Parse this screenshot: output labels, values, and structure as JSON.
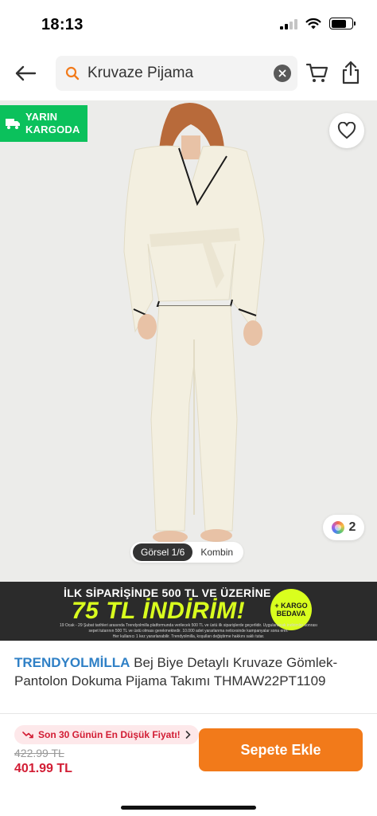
{
  "status": {
    "time": "18:13"
  },
  "search": {
    "value": "Kruvaze Pijama"
  },
  "badge": {
    "line1": "YARIN",
    "line2": "KARGODA",
    "color": "#0bc15c"
  },
  "gallery": {
    "active_label": "Görsel 1/6",
    "other_label": "Kombin",
    "color_count": "2"
  },
  "promo": {
    "line1": "İLK SİPARİŞİNDE 500 TL VE ÜZERİNE",
    "line2": "75 TL İNDİRİM!",
    "badge_line1": "+ KARGO",
    "badge_line2": "BEDAVA",
    "fine_print": [
      "19 Ocak - 29 Şubat tarihleri arasında Trendyolmilla platformunda verilecek 500 TL ve üstü ilk siparişlerde geçerlidir. Uygulanacak indirimler sonrası",
      "sepet tutarının 500 TL ve üstü olması gerekmektedir. 10.000 adet yararlanma neticesinde kampanyalar sona erer.",
      "Her kullanıcı 1 kez yararlanabilir. Trendyolmilla, koşulları değiştirme hakkını saklı tutar."
    ],
    "accent": "#d9ff1e"
  },
  "product": {
    "brand": "TRENDYOLMİLLA",
    "title": "Bej Biye Detaylı Kruvaze Gömlek-Pantolon Dokuma Pijama Takımı THMAW22PT1109",
    "brand_color": "#2f80c6"
  },
  "price": {
    "lowest_label": "Son 30 Günün En Düşük Fiyatı!",
    "old": "422.99 TL",
    "new": "401.99 TL",
    "sale_color": "#d21d34"
  },
  "actions": {
    "add_to_cart": "Sepete Ekle",
    "accent": "#f27a1a"
  },
  "icons": [
    "back-arrow-icon",
    "search-icon",
    "clear-icon",
    "cart-icon",
    "share-icon",
    "truck-icon",
    "heart-icon",
    "trend-down-icon",
    "chevron-right-icon"
  ]
}
